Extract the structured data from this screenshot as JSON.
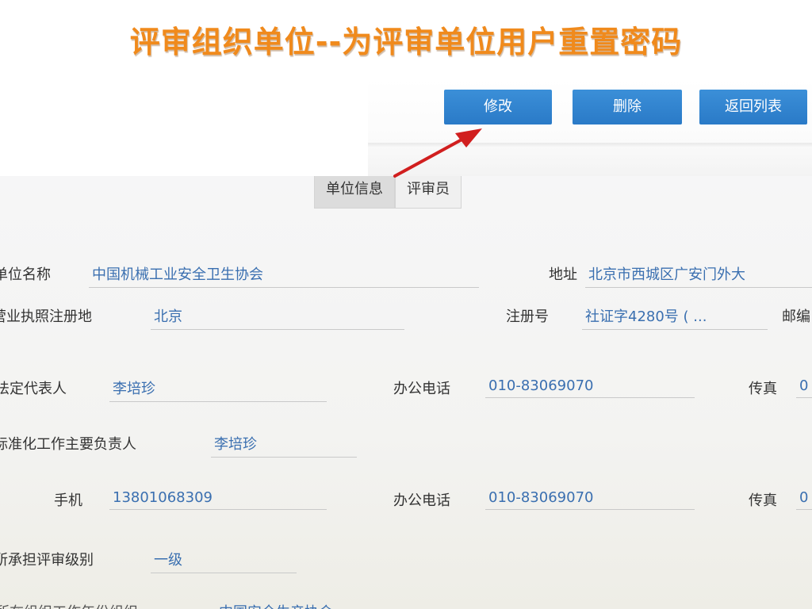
{
  "slide_title": "评审组织单位--为评审单位用户重置密码",
  "toolbar": {
    "edit_label": "修改",
    "delete_label": "删除",
    "back_label": "返回列表"
  },
  "tabs": [
    {
      "label": "单位信息",
      "active": true
    },
    {
      "label": "评审员",
      "active": false
    }
  ],
  "form": {
    "unit_name": {
      "label": "单位名称",
      "value": "中国机械工业安全卫生协会"
    },
    "address": {
      "label": "地址",
      "value": "北京市西城区广安门外大"
    },
    "license_place": {
      "label": "营业执照注册地",
      "value": "北京"
    },
    "reg_no": {
      "label": "注册号",
      "value": "社证字4280号 ( ..."
    },
    "postcode": {
      "label": "邮编"
    },
    "legal_rep": {
      "label": "法定代表人",
      "value": "李培珍"
    },
    "office_phone_1": {
      "label": "办公电话",
      "value": "010-83069070"
    },
    "fax_1": {
      "label": "传真",
      "value": "0"
    },
    "std_person": {
      "label": "标准化工作主要负责人",
      "value": "李培珍"
    },
    "mobile": {
      "label": "手机",
      "value": "13801068309"
    },
    "office_phone_2": {
      "label": "办公电话",
      "value": "010-83069070"
    },
    "fax_2": {
      "label": "传真",
      "value": "0"
    },
    "review_level": {
      "label": "所承担评审级别",
      "value": "一级"
    },
    "partial_label": "所在组织工作年份组织",
    "partial_value": "中国安全生产协会"
  },
  "colors": {
    "title": "#f08a1c",
    "button": "#2a7ac7",
    "value_text": "#3a6fb0",
    "arrow": "#d11f1f"
  }
}
